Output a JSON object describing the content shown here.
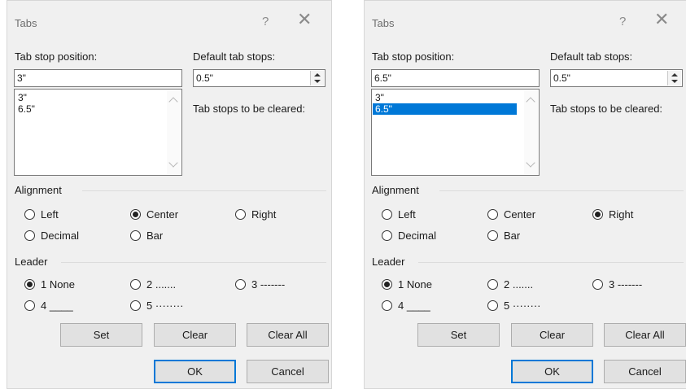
{
  "dialogs": [
    {
      "title": "Tabs",
      "help_glyph": "?",
      "close_glyph": "✕",
      "tab_stop_position_label": "Tab stop position:",
      "tab_stop_position_value": "3\"",
      "default_tab_stops_label": "Default tab stops:",
      "default_tab_stops_value": "0.5\"",
      "tab_stops_to_clear_label": "Tab stops to be cleared:",
      "tab_stops": [
        "3\"",
        "6.5\""
      ],
      "selected_tab_stop_index": -1,
      "alignment_label": "Alignment",
      "alignment_options": [
        "Left",
        "Center",
        "Right",
        "Decimal",
        "Bar"
      ],
      "alignment_selected": "Center",
      "leader_label": "Leader",
      "leader_options": [
        "1 None",
        "2 .......",
        "3 -------",
        "4 ____",
        "5 ········"
      ],
      "leader_selected": "1 None",
      "buttons": {
        "set": "Set",
        "clear": "Clear",
        "clear_all": "Clear All",
        "ok": "OK",
        "cancel": "Cancel"
      }
    },
    {
      "title": "Tabs",
      "help_glyph": "?",
      "close_glyph": "✕",
      "tab_stop_position_label": "Tab stop position:",
      "tab_stop_position_value": "6.5\"",
      "default_tab_stops_label": "Default tab stops:",
      "default_tab_stops_value": "0.5\"",
      "tab_stops_to_clear_label": "Tab stops to be cleared:",
      "tab_stops": [
        "3\"",
        "6.5\""
      ],
      "selected_tab_stop_index": 1,
      "alignment_label": "Alignment",
      "alignment_options": [
        "Left",
        "Center",
        "Right",
        "Decimal",
        "Bar"
      ],
      "alignment_selected": "Right",
      "leader_label": "Leader",
      "leader_options": [
        "1 None",
        "2 .......",
        "3 -------",
        "4 ____",
        "5 ········"
      ],
      "leader_selected": "1 None",
      "buttons": {
        "set": "Set",
        "clear": "Clear",
        "clear_all": "Clear All",
        "ok": "OK",
        "cancel": "Cancel"
      }
    }
  ],
  "colors": {
    "accent": "#0078d7",
    "dialog_bg": "#f0f0f0",
    "button_bg": "#e1e1e1"
  }
}
